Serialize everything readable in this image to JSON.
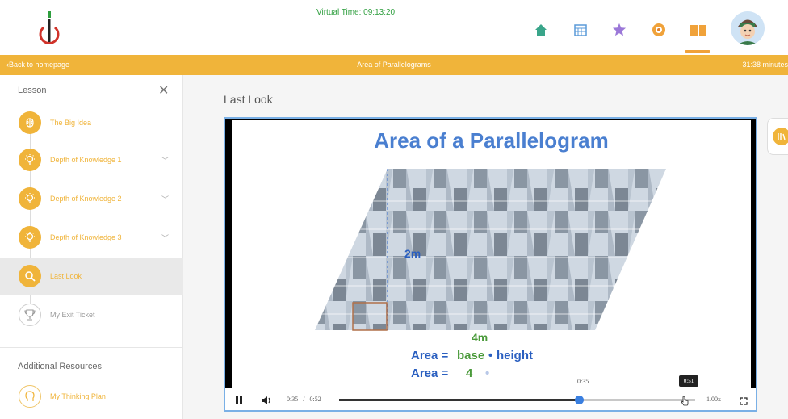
{
  "header": {
    "virtual_time": "Virtual Time: 09:13:20",
    "nav_icons": [
      "home-icon",
      "calendar-icon",
      "star-icon",
      "badge-icon",
      "book-icon"
    ],
    "colors": {
      "accent": "#f0b43a",
      "brand_green": "#2e9e3e",
      "brand_red": "#d0322a"
    }
  },
  "subheader": {
    "back_label": "Back to homepage",
    "title": "Area of Parallelograms",
    "minutes": "31:38 minutes"
  },
  "sidebar": {
    "lesson_heading": "Lesson",
    "items": [
      {
        "label": "The Big Idea",
        "icon": "brain-icon"
      },
      {
        "label": "Depth of Knowledge 1",
        "icon": "lightbulb-icon"
      },
      {
        "label": "Depth of Knowledge 2",
        "icon": "lightbulb-icon"
      },
      {
        "label": "Depth of Knowledge 3",
        "icon": "lightbulb-icon"
      },
      {
        "label": "Last Look",
        "icon": "magnifier-icon"
      },
      {
        "label": "My Exit Ticket",
        "icon": "trophy-icon"
      }
    ],
    "additional_heading": "Additional Resources",
    "additional_items": [
      {
        "label": "My Thinking Plan",
        "icon": "head-icon"
      }
    ]
  },
  "main": {
    "section_title": "Last Look"
  },
  "video": {
    "slide_title": "Area of a Parallelogram",
    "height_label": "2m",
    "base_label": "4m",
    "formula_line1": {
      "lhs": "Area =",
      "base": "base",
      "dot": "•",
      "height": "height"
    },
    "formula_line2": {
      "lhs": "Area =",
      "value": "4",
      "dot": "•"
    },
    "current_time": "0:35",
    "duration": "0:52",
    "time_separator": "/",
    "progress": 0.673,
    "hover_time": "0:35",
    "tooltip_time": "0:51",
    "playback_rate": "1.00x"
  }
}
